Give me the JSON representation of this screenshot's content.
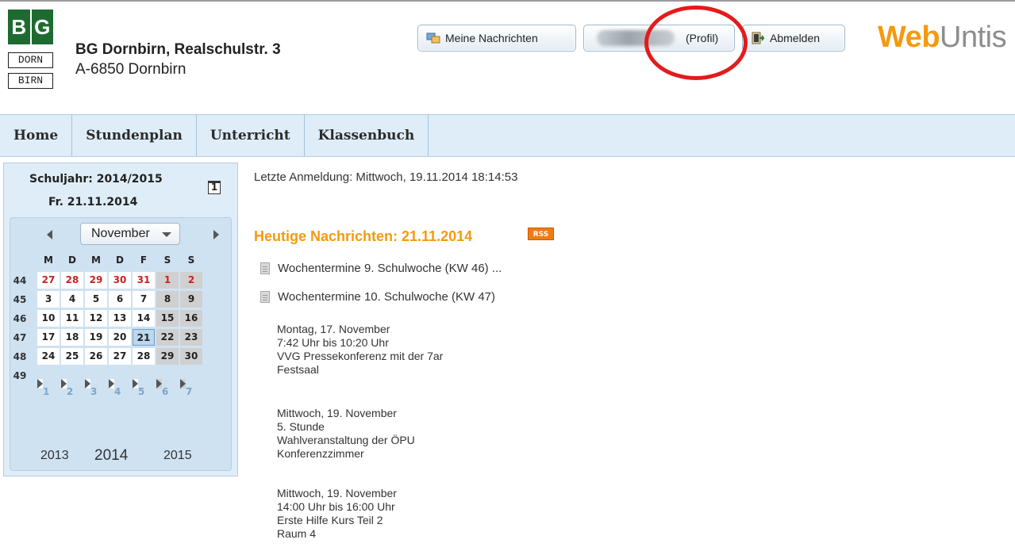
{
  "header": {
    "logo": {
      "top_left": "B",
      "top_right": "G",
      "line1": "DORN",
      "line2": "BIRN"
    },
    "school_name": "BG Dornbirn, Realschulstr. 3",
    "school_address": "A-6850 Dornbirn",
    "btn_messages": "Meine Nachrichten",
    "btn_profile": "(Profil)",
    "btn_logout": "Abmelden",
    "brand_web": "Web",
    "brand_untis": "Untis"
  },
  "nav": {
    "items": [
      "Home",
      "Stundenplan",
      "Unterricht",
      "Klassenbuch"
    ]
  },
  "sidebar": {
    "school_year": "Schuljahr: 2014/2015",
    "date": "Fr. 21.11.2014",
    "calendar_icon_text": "1",
    "month": "November",
    "day_headers": [
      "M",
      "D",
      "M",
      "D",
      "F",
      "S",
      "S"
    ],
    "weeks": [
      {
        "wk": "44",
        "days": [
          "27",
          "28",
          "29",
          "30",
          "31",
          "1",
          "2"
        ]
      },
      {
        "wk": "45",
        "days": [
          "3",
          "4",
          "5",
          "6",
          "7",
          "8",
          "9"
        ]
      },
      {
        "wk": "46",
        "days": [
          "10",
          "11",
          "12",
          "13",
          "14",
          "15",
          "16"
        ]
      },
      {
        "wk": "47",
        "days": [
          "17",
          "18",
          "19",
          "20",
          "21",
          "22",
          "23"
        ]
      },
      {
        "wk": "48",
        "days": [
          "24",
          "25",
          "26",
          "27",
          "28",
          "29",
          "30"
        ]
      },
      {
        "wk": "49",
        "days": [
          "1",
          "2",
          "3",
          "4",
          "5",
          "6",
          "7"
        ]
      }
    ],
    "years": [
      "2013",
      "2014",
      "2015"
    ]
  },
  "main": {
    "last_login": "Letzte Anmeldung: Mittwoch, 19.11.2014 18:14:53",
    "news_title": "Heutige Nachrichten: 21.11.2014",
    "rss": "RSS",
    "news_items": [
      "Wochentermine 9. Schulwoche (KW 46) ...",
      "Wochentermine 10. Schulwoche (KW 47)"
    ],
    "entries": [
      [
        "Montag, 17. November",
        "7:42 Uhr bis 10:20 Uhr",
        "VVG Pressekonferenz mit der 7ar",
        "Festsaal"
      ],
      [
        "Mittwoch, 19. November",
        "5. Stunde",
        "Wahlveranstaltung der ÖPU",
        "Konferenzzimmer"
      ],
      [
        "Mittwoch, 19. November",
        "14:00 Uhr bis 16:00 Uhr",
        "Erste Hilfe Kurs Teil 2",
        "Raum 4"
      ]
    ]
  },
  "colors": {
    "brand_orange": "#f39a10",
    "brand_gray": "#8d8d8d",
    "highlight_red": "#e31b1b",
    "nav_bg": "#deedf8"
  }
}
